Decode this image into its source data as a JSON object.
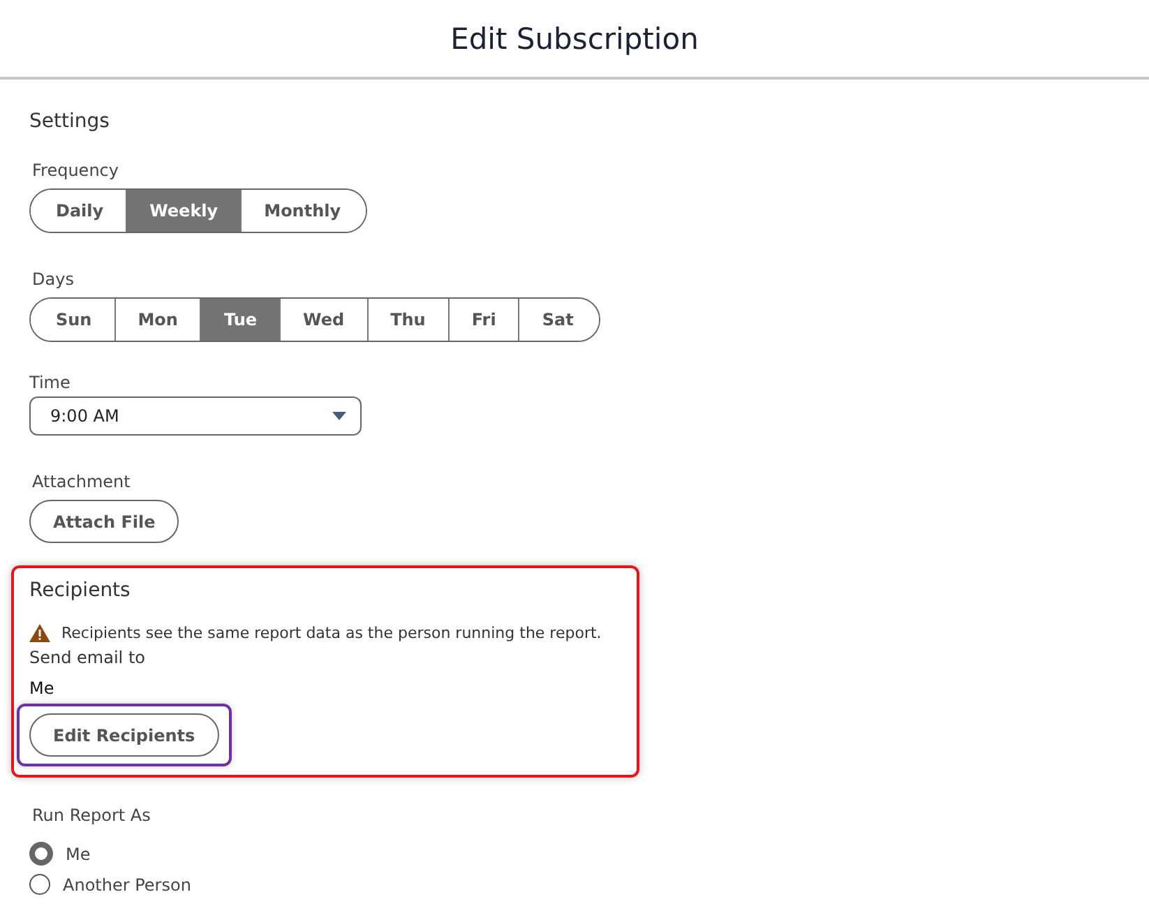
{
  "title": "Edit Subscription",
  "settings": {
    "heading": "Settings",
    "frequency": {
      "label": "Frequency",
      "options": [
        {
          "label": "Daily",
          "selected": false
        },
        {
          "label": "Weekly",
          "selected": true
        },
        {
          "label": "Monthly",
          "selected": false
        }
      ]
    },
    "days": {
      "label": "Days",
      "options": [
        {
          "label": "Sun",
          "selected": false
        },
        {
          "label": "Mon",
          "selected": false
        },
        {
          "label": "Tue",
          "selected": true
        },
        {
          "label": "Wed",
          "selected": false
        },
        {
          "label": "Thu",
          "selected": false
        },
        {
          "label": "Fri",
          "selected": false
        },
        {
          "label": "Sat",
          "selected": false
        }
      ]
    },
    "time": {
      "label": "Time",
      "value": "9:00 AM"
    },
    "attachment": {
      "label": "Attachment",
      "button": "Attach File"
    }
  },
  "recipients": {
    "heading": "Recipients",
    "warning": "Recipients see the same report data as the person running the report.",
    "send_label": "Send email to",
    "send_value": "Me",
    "button": "Edit Recipients"
  },
  "run_as": {
    "label": "Run Report As",
    "options": [
      {
        "label": "Me",
        "selected": true
      },
      {
        "label": "Another Person",
        "selected": false
      }
    ]
  }
}
